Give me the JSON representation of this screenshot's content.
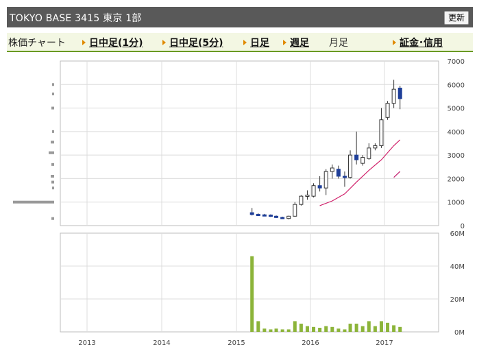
{
  "header": {
    "title": "TOKYO BASE  3415  東京 1部",
    "refresh_label": "更新"
  },
  "nav": {
    "label": "株価チャート",
    "links": [
      "日中足(1分)",
      "日中足(5分)",
      "日足",
      "週足"
    ],
    "current": "月足",
    "extra": "証金･信用"
  },
  "colors": {
    "accent": "#6a9a23",
    "arrow": "#e08a00",
    "candle_down": "#1f3f99",
    "candle_up": "#ffffff",
    "ma_short": "#d0206a",
    "ma_long": "#c0186a",
    "volume": "#8cb43a"
  },
  "chart_data": [
    {
      "type": "candlestick",
      "title": "",
      "x_ticks": [
        "2013",
        "2014",
        "2015",
        "2016",
        "2017"
      ],
      "y_ticks": [
        "7000",
        "6000",
        "5000",
        "4000",
        "3000",
        "2000",
        "1000",
        "0"
      ],
      "ylim": [
        0,
        7000
      ],
      "grid": true,
      "candles": [
        {
          "date": "2015-09",
          "open": 550,
          "high": 750,
          "low": 430,
          "close": 470
        },
        {
          "date": "2015-10",
          "open": 480,
          "high": 520,
          "low": 420,
          "close": 450
        },
        {
          "date": "2015-11",
          "open": 460,
          "high": 500,
          "low": 410,
          "close": 430
        },
        {
          "date": "2015-12",
          "open": 450,
          "high": 480,
          "low": 370,
          "close": 390
        },
        {
          "date": "2016-01",
          "open": 400,
          "high": 430,
          "low": 320,
          "close": 350
        },
        {
          "date": "2016-02",
          "open": 350,
          "high": 380,
          "low": 280,
          "close": 310
        },
        {
          "date": "2016-03",
          "open": 300,
          "high": 420,
          "low": 270,
          "close": 400
        },
        {
          "date": "2016-04",
          "open": 400,
          "high": 1000,
          "low": 380,
          "close": 900
        },
        {
          "date": "2016-05",
          "open": 900,
          "high": 1300,
          "low": 850,
          "close": 1250
        },
        {
          "date": "2016-06",
          "open": 1250,
          "high": 1500,
          "low": 1100,
          "close": 1300
        },
        {
          "date": "2016-07",
          "open": 1250,
          "high": 1800,
          "low": 1200,
          "close": 1700
        },
        {
          "date": "2016-08",
          "open": 1700,
          "high": 2100,
          "low": 1450,
          "close": 1600
        },
        {
          "date": "2016-09",
          "open": 1600,
          "high": 2400,
          "low": 1300,
          "close": 2300
        },
        {
          "date": "2016-10",
          "open": 2300,
          "high": 2600,
          "low": 2000,
          "close": 2450
        },
        {
          "date": "2016-11",
          "open": 2400,
          "high": 2550,
          "low": 2000,
          "close": 2100
        },
        {
          "date": "2016-12",
          "open": 2100,
          "high": 2300,
          "low": 1650,
          "close": 2050
        },
        {
          "date": "2017-01",
          "open": 2050,
          "high": 3200,
          "low": 2000,
          "close": 3000
        },
        {
          "date": "2017-02",
          "open": 3000,
          "high": 4000,
          "low": 2600,
          "close": 2800
        },
        {
          "date": "2017-03",
          "open": 2650,
          "high": 3000,
          "low": 2550,
          "close": 2900
        },
        {
          "date": "2017-04",
          "open": 2850,
          "high": 3500,
          "low": 2800,
          "close": 3300
        },
        {
          "date": "2017-05",
          "open": 3300,
          "high": 3500,
          "low": 3200,
          "close": 3400
        },
        {
          "date": "2017-06",
          "open": 3400,
          "high": 5000,
          "low": 3300,
          "close": 4500
        },
        {
          "date": "2017-07",
          "open": 4600,
          "high": 5300,
          "low": 4500,
          "close": 5200
        },
        {
          "date": "2017-08",
          "open": 5200,
          "high": 6200,
          "low": 5000,
          "close": 5800
        },
        {
          "date": "2017-09",
          "open": 5850,
          "high": 5950,
          "low": 4950,
          "close": 5400
        }
      ],
      "moving_average_short": [
        {
          "date": "2016-08",
          "value": 850
        },
        {
          "date": "2016-10",
          "value": 1050
        },
        {
          "date": "2016-12",
          "value": 1350
        },
        {
          "date": "2017-02",
          "value": 1850
        },
        {
          "date": "2017-04",
          "value": 2350
        },
        {
          "date": "2017-06",
          "value": 2800
        },
        {
          "date": "2017-08",
          "value": 3400
        },
        {
          "date": "2017-09",
          "value": 3650
        }
      ],
      "moving_average_long": [
        {
          "date": "2017-08",
          "value": 2050
        },
        {
          "date": "2017-09",
          "value": 2300
        }
      ]
    },
    {
      "type": "bar",
      "title": "",
      "y_ticks": [
        "60M",
        "40M",
        "20M",
        "0M"
      ],
      "ylim": [
        0,
        60
      ],
      "unit": "M",
      "volume": [
        {
          "date": "2015-09",
          "value": 46
        },
        {
          "date": "2015-10",
          "value": 6.5
        },
        {
          "date": "2015-11",
          "value": 2
        },
        {
          "date": "2015-12",
          "value": 1.5
        },
        {
          "date": "2016-01",
          "value": 2
        },
        {
          "date": "2016-02",
          "value": 1.5
        },
        {
          "date": "2016-03",
          "value": 1.5
        },
        {
          "date": "2016-04",
          "value": 6.5
        },
        {
          "date": "2016-05",
          "value": 5
        },
        {
          "date": "2016-06",
          "value": 3.5
        },
        {
          "date": "2016-07",
          "value": 3
        },
        {
          "date": "2016-08",
          "value": 2.5
        },
        {
          "date": "2016-09",
          "value": 3.5
        },
        {
          "date": "2016-10",
          "value": 3
        },
        {
          "date": "2016-11",
          "value": 2
        },
        {
          "date": "2016-12",
          "value": 1.5
        },
        {
          "date": "2017-01",
          "value": 5
        },
        {
          "date": "2017-02",
          "value": 5
        },
        {
          "date": "2017-03",
          "value": 3.5
        },
        {
          "date": "2017-04",
          "value": 6.5
        },
        {
          "date": "2017-05",
          "value": 3.5
        },
        {
          "date": "2017-06",
          "value": 6.5
        },
        {
          "date": "2017-07",
          "value": 5.5
        },
        {
          "date": "2017-08",
          "value": 4
        },
        {
          "date": "2017-09",
          "value": 3
        }
      ]
    }
  ]
}
